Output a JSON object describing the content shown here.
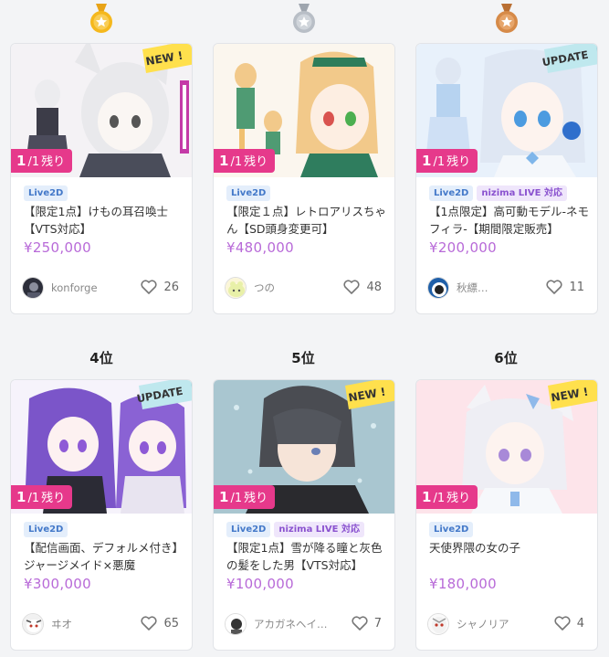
{
  "rank_labels": [
    "4位",
    "5位",
    "6位"
  ],
  "colors": {
    "gold": "#f5b81d",
    "silver": "#b8bec6",
    "bronze": "#d68a48",
    "remain_badge": "#e6398b",
    "price": "#b86ad8",
    "new_ribbon": "#ffe04d",
    "update_ribbon": "#bfe8ee"
  },
  "cards": [
    {
      "remain": {
        "num": "1",
        "den": "/1",
        "suffix": "残り"
      },
      "ribbon": "NEW !",
      "tags": [
        "Live2D"
      ],
      "title": "【限定1点】けもの耳召喚士【VTS対応】",
      "price": "¥250,000",
      "creator": "konforge",
      "likes": "26"
    },
    {
      "remain": {
        "num": "1",
        "den": "/1",
        "suffix": "残り"
      },
      "ribbon": "",
      "tags": [
        "Live2D"
      ],
      "title": "【限定１点】レトロアリスちゃん【SD頭身変更可】",
      "price": "¥480,000",
      "creator": "つの",
      "likes": "48"
    },
    {
      "remain": {
        "num": "1",
        "den": "/1",
        "suffix": "残り"
      },
      "ribbon": "UPDATE",
      "tags": [
        "Live2D",
        "nizima LIVE 対応"
      ],
      "title": "【1点限定】高可動モデル-ネモフィラ-【期間限定販売】",
      "price": "¥200,000",
      "creator": "秋縹…",
      "likes": "11"
    },
    {
      "remain": {
        "num": "1",
        "den": "/1",
        "suffix": "残り"
      },
      "ribbon": "UPDATE",
      "tags": [
        "Live2D"
      ],
      "title": "【配信画面、デフォルメ付き】ジャージメイド×悪魔",
      "price": "¥300,000",
      "creator": "ヰオ",
      "likes": "65"
    },
    {
      "remain": {
        "num": "1",
        "den": "/1",
        "suffix": "残り"
      },
      "ribbon": "NEW !",
      "tags": [
        "Live2D",
        "nizima LIVE 対応"
      ],
      "title": "【限定1点】雪が降る瞳と灰色の髪をした男【VTS対応】",
      "price": "¥100,000",
      "creator": "アカガネヘイシ…",
      "likes": "7"
    },
    {
      "remain": {
        "num": "1",
        "den": "/1",
        "suffix": "残り"
      },
      "ribbon": "NEW !",
      "tags": [
        "Live2D"
      ],
      "title": "天使界隈の女の子",
      "price": "¥180,000",
      "creator": "シャノリア",
      "likes": "4"
    }
  ]
}
